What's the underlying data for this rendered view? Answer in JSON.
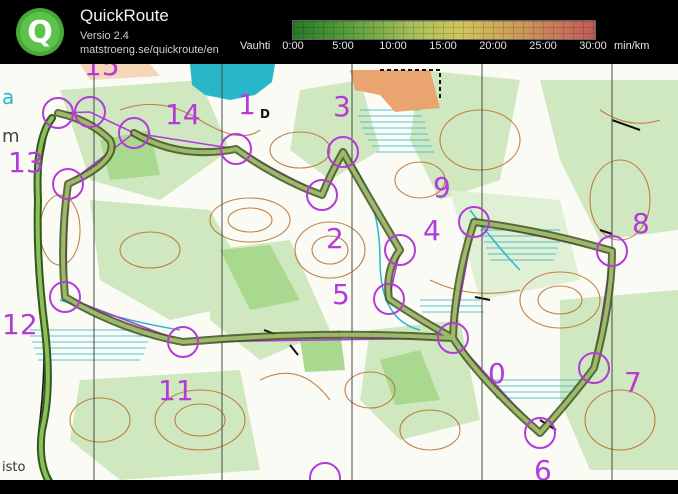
{
  "header": {
    "app_name": "QuickRoute",
    "version": "Versio 2.4",
    "url": "matstroeng.se/quickroute/en",
    "logo_letter": "Q",
    "pace_label": "Vauhti",
    "pace_ticks": [
      "0:00",
      "5:00",
      "10:00",
      "15:00",
      "20:00",
      "25:00",
      "30:00"
    ],
    "pace_unit": "min/km"
  },
  "map": {
    "controls": [
      {
        "label": "13",
        "visible_text": "13"
      },
      {
        "label": "14",
        "visible_text": "14"
      },
      {
        "label": "1",
        "visible_text": "1"
      },
      {
        "label": "3",
        "visible_text": "3"
      },
      {
        "label": "2",
        "visible_text": "2"
      },
      {
        "label": "9",
        "visible_text": "9"
      },
      {
        "label": "4",
        "visible_text": "4"
      },
      {
        "label": "8",
        "visible_text": "8"
      },
      {
        "label": "5",
        "visible_text": "5"
      },
      {
        "label": "12",
        "visible_text": "12"
      },
      {
        "label": "11",
        "visible_text": "11"
      },
      {
        "label": "10",
        "visible_text": "0"
      },
      {
        "label": "7",
        "visible_text": "7"
      },
      {
        "label": "6",
        "visible_text": "6"
      },
      {
        "label": "15",
        "visible_text": "15"
      }
    ],
    "edge_text_left_top": "a",
    "edge_text_left_mid": "m",
    "edge_text_bottom_left": "isto",
    "small_letter": "D"
  },
  "colors": {
    "course": "#b43ad9",
    "route": "#6b7a3a",
    "water": "#29b6c8",
    "forest": "#cfe8c0",
    "contour": "#b86d2a",
    "road": "#e09a6a"
  }
}
